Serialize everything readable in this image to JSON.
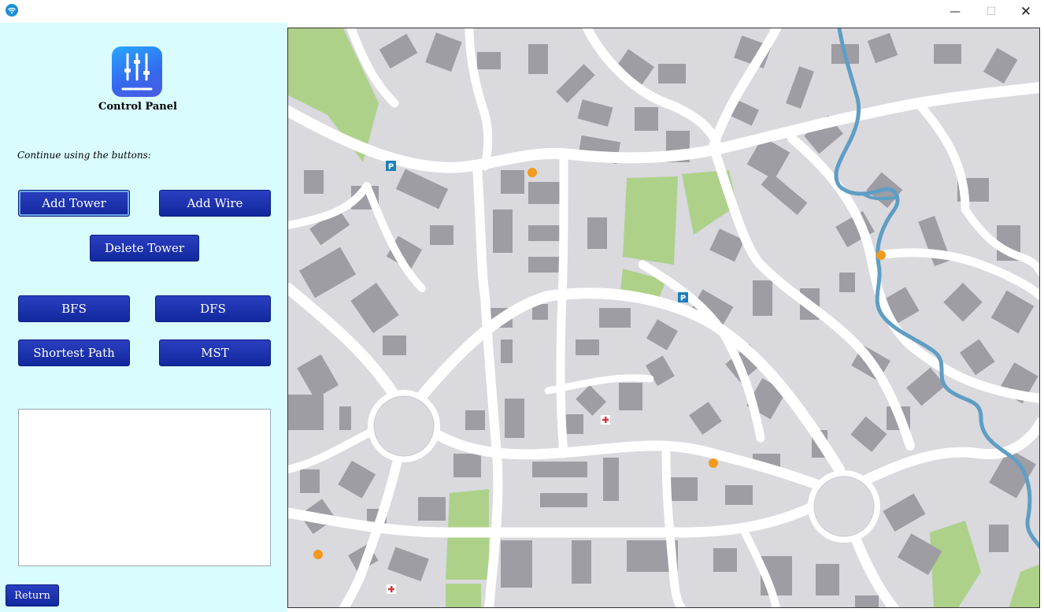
{
  "window": {
    "minimize_glyph": "—",
    "maximize_glyph": "☐",
    "close_glyph": "✕"
  },
  "panel": {
    "title": "Control Panel",
    "hint": "Continue using the buttons:",
    "logo_icon": "sliders-icon"
  },
  "buttons": {
    "add_tower": "Add Tower",
    "add_wire": "Add Wire",
    "delete_tower": "Delete Tower",
    "bfs": "BFS",
    "dfs": "DFS",
    "shortest_path": "Shortest Path",
    "mst": "MST",
    "return": "Return"
  },
  "output_text": "",
  "map": {
    "markers": {
      "parking_label": "P",
      "hospital_icon": "cross-icon",
      "poi_icon": "orange-dot-icon"
    }
  },
  "colors": {
    "panel_bg": "#d9fcfe",
    "button_bg": "#1b31ad",
    "road": "#ffffff",
    "block": "#d9d9de",
    "building": "#9d9da3",
    "park": "#aed18a",
    "river": "#5f9ec4",
    "poi": "#f39a1e",
    "parking": "#1f7fba"
  }
}
